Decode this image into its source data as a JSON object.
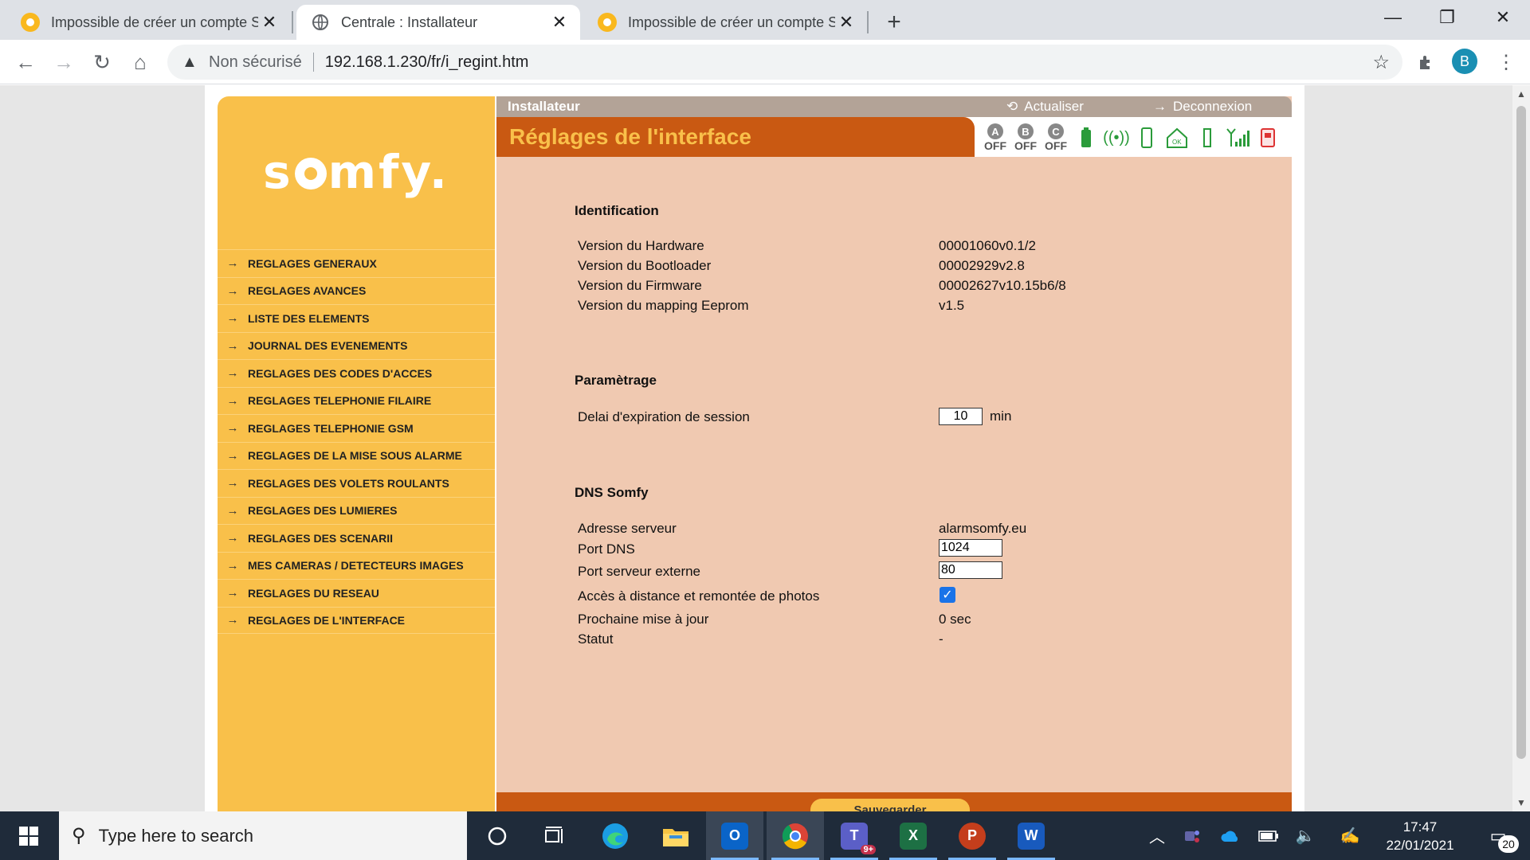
{
  "browser": {
    "tabs": [
      {
        "title": "Impossible de créer un compte S",
        "close": "✕"
      },
      {
        "title": "Centrale  : Installateur",
        "close": "✕"
      },
      {
        "title": "Impossible de créer un compte S",
        "close": "✕"
      }
    ],
    "new_tab": "+",
    "window_controls": {
      "minimize": "—",
      "restore": "❐",
      "close": "✕"
    },
    "nav": {
      "back": "←",
      "forward": "→",
      "reload": "↻",
      "home": "⌂"
    },
    "security_label": "Non sécurisé",
    "url": "192.168.1.230/fr/i_regint.htm",
    "profile_initial": "B"
  },
  "page": {
    "logo_text": "somfy.",
    "menu": [
      "REGLAGES GENERAUX",
      "REGLAGES AVANCES",
      "LISTE DES ELEMENTS",
      "JOURNAL DES EVENEMENTS",
      "REGLAGES DES CODES D'ACCES",
      "REGLAGES TELEPHONIE FILAIRE",
      "REGLAGES TELEPHONIE GSM",
      "REGLAGES DE LA MISE SOUS ALARME",
      "REGLAGES DES VOLETS ROULANTS",
      "REGLAGES DES LUMIERES",
      "REGLAGES DES SCENARII",
      "MES CAMERAS / DETECTEURS IMAGES",
      "REGLAGES DU RESEAU",
      "REGLAGES DE L'INTERFACE"
    ],
    "topstrip": {
      "role": "Installateur",
      "refresh": "Actualiser",
      "logout": "Deconnexion"
    },
    "title": "Réglages de l'interface",
    "zones": [
      {
        "letter": "A",
        "state": "OFF"
      },
      {
        "letter": "B",
        "state": "OFF"
      },
      {
        "letter": "C",
        "state": "OFF"
      }
    ],
    "identification": {
      "heading": "Identification",
      "rows": [
        {
          "label": "Version du Hardware",
          "value": "00001060v0.1/2"
        },
        {
          "label": "Version du Bootloader",
          "value": "00002929v2.8"
        },
        {
          "label": "Version du Firmware",
          "value": "00002627v10.15b6/8"
        },
        {
          "label": "Version du mapping Eeprom",
          "value": "v1.5"
        }
      ]
    },
    "parametrage": {
      "heading": "Paramètrage",
      "session_label": "Delai d'expiration de session",
      "session_value": "10",
      "session_unit": "min"
    },
    "dns": {
      "heading": "DNS Somfy",
      "server_label": "Adresse serveur",
      "server_value": "alarmsomfy.eu",
      "port_dns_label": "Port DNS",
      "port_dns_value": "1024",
      "port_ext_label": "Port serveur externe",
      "port_ext_value": "80",
      "remote_label": "Accès à distance et remontée de photos",
      "remote_checked": true,
      "next_update_label": "Prochaine mise à jour",
      "next_update_value": "0 sec",
      "status_label": "Statut",
      "status_value": "-"
    },
    "save_label": "Sauvegarder"
  },
  "taskbar": {
    "search_placeholder": "Type here to search",
    "time": "17:47",
    "date": "22/01/2021",
    "notifications": "20",
    "teams_badge": "9+"
  }
}
